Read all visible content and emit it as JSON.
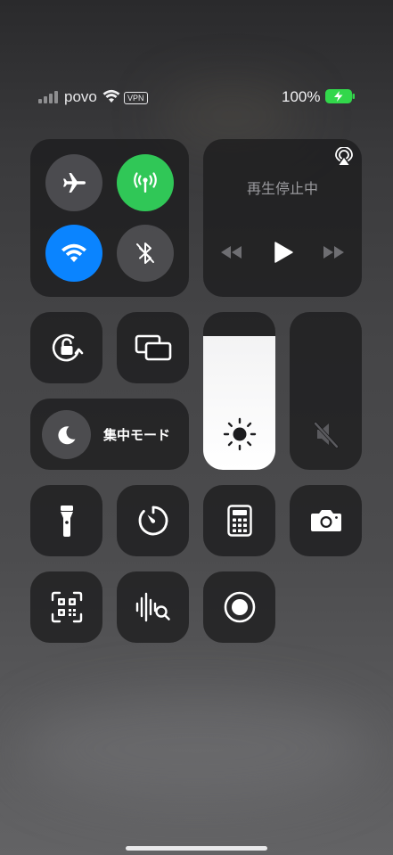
{
  "status_bar": {
    "carrier": "povo",
    "vpn": "VPN",
    "battery_percent": "100%",
    "signal_bars_active": 0,
    "charging": true,
    "battery_color": "#32d74b"
  },
  "connectivity": {
    "airplane_mode": {
      "icon": "airplane-icon",
      "active": false
    },
    "cellular_data": {
      "icon": "antenna-icon",
      "active": true,
      "color": "#30c757"
    },
    "wifi": {
      "icon": "wifi-icon",
      "active": true,
      "color": "#0a84ff"
    },
    "bluetooth": {
      "icon": "bluetooth-off-icon",
      "active": false
    }
  },
  "now_playing": {
    "status": "再生停止中",
    "airplay_icon": "airplay-icon",
    "controls": [
      "rewind-icon",
      "play-icon",
      "fast-forward-icon"
    ]
  },
  "controls": {
    "orientation_lock": {
      "icon": "rotation-lock-icon"
    },
    "screen_mirroring": {
      "icon": "screen-mirroring-icon"
    },
    "focus": {
      "label": "集中モード",
      "icon": "moon-icon"
    }
  },
  "sliders": {
    "brightness": {
      "icon": "sun-icon",
      "level": 0.85
    },
    "volume": {
      "icon": "speaker-muted-icon",
      "level": 0
    }
  },
  "shortcuts": [
    {
      "name": "flashlight",
      "icon": "flashlight-icon"
    },
    {
      "name": "timer",
      "icon": "timer-icon"
    },
    {
      "name": "calculator",
      "icon": "calculator-icon"
    },
    {
      "name": "camera",
      "icon": "camera-icon"
    },
    {
      "name": "code-scanner",
      "icon": "qr-scanner-icon"
    },
    {
      "name": "music-recognition",
      "icon": "sound-search-icon"
    },
    {
      "name": "screen-recording",
      "icon": "record-icon"
    }
  ]
}
